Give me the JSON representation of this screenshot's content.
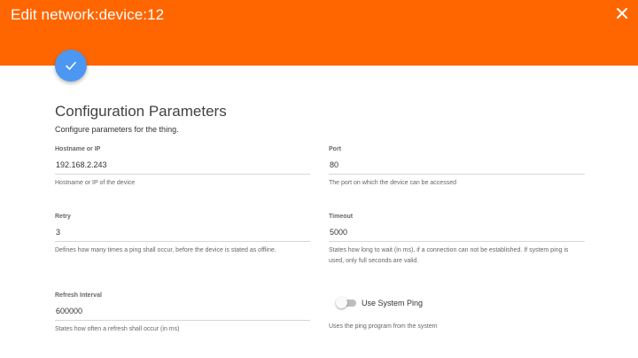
{
  "header": {
    "title": "Edit network:device:12",
    "close_icon": "close-icon",
    "color": "#ff6600"
  },
  "save_fab": {
    "icon": "check-icon",
    "color": "#4c97f2"
  },
  "section": {
    "title": "Configuration Parameters",
    "description": "Configure parameters for the thing."
  },
  "fields": {
    "hostname": {
      "label": "Hostname or IP",
      "value": "192.168.2.243",
      "help": "Hostname or IP of the device"
    },
    "port": {
      "label": "Port",
      "value": "80",
      "help": "The port on which the device can be accessed"
    },
    "retry": {
      "label": "Retry",
      "value": "3",
      "help": "Defines how many times a ping shall occur, before the device is stated as offline."
    },
    "timeout": {
      "label": "Timeout",
      "value": "5000",
      "help": "States how long to wait (in ms), if a connection can not be established. If system ping is used, only full seconds are valid."
    },
    "refresh": {
      "label": "Refresh Interval",
      "value": "600000",
      "help": "States how often a refresh shall occur (in ms)"
    }
  },
  "system_ping": {
    "label": "Use System Ping",
    "enabled": false,
    "help": "Uses the ping program from the system"
  }
}
